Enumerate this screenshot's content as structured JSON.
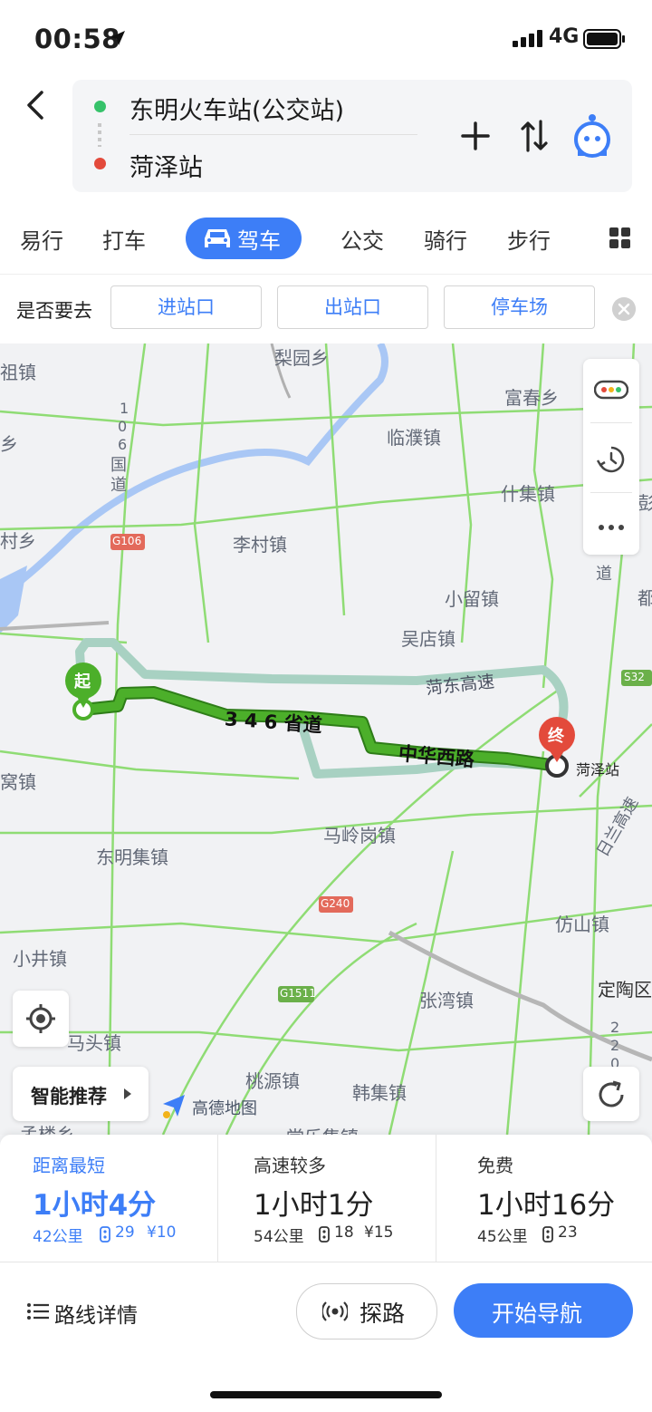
{
  "status_bar": {
    "time": "00:58",
    "network": "4G"
  },
  "route": {
    "start": "东明火车站(公交站)",
    "end": "菏泽站"
  },
  "modes": {
    "items": [
      "易行",
      "打车",
      "驾车",
      "公交",
      "骑行",
      "步行"
    ],
    "active": "驾车"
  },
  "destination_prompt": {
    "question": "是否要去",
    "options": [
      "进站口",
      "出站口",
      "停车场"
    ]
  },
  "map": {
    "place_labels": [
      "梨园乡",
      "祖镇",
      "富春乡",
      "临濮镇",
      "1",
      "0",
      "6",
      "国",
      "道",
      "G106",
      "李村镇",
      "什集镇",
      "小留镇",
      "吴店镇",
      "菏东高速",
      "S32",
      "起",
      "终",
      "3 4 6 省道",
      "中华西路",
      "菏泽站",
      "窝镇",
      "马岭岗镇",
      "东明集镇",
      "G240",
      "仿山镇",
      "小井镇",
      "G1511",
      "张湾镇",
      "定陶区",
      "马头镇",
      "桃源镇",
      "韩集镇",
      "日兰高速",
      "2",
      "2",
      "0",
      "孟楼乡",
      "堂乐集镇",
      "道",
      "乡",
      "彭",
      "都",
      "村乡"
    ],
    "smart_button": "智能推荐",
    "brand": "高德地图",
    "accent_color": "#3d7ef7",
    "route_color": "#4caf2a"
  },
  "route_options": [
    {
      "title": "距离最短",
      "duration": "1小时4分",
      "distance": "42公里",
      "lights": "29",
      "toll": "¥10",
      "selected": true
    },
    {
      "title": "高速较多",
      "duration": "1小时1分",
      "distance": "54公里",
      "lights": "18",
      "toll": "¥15",
      "selected": false
    },
    {
      "title": "免费",
      "duration": "1小时16分",
      "distance": "45公里",
      "lights": "23",
      "toll": "",
      "selected": false
    }
  ],
  "actions": {
    "details": "路线详情",
    "explore": "探路",
    "navigate": "开始导航"
  }
}
